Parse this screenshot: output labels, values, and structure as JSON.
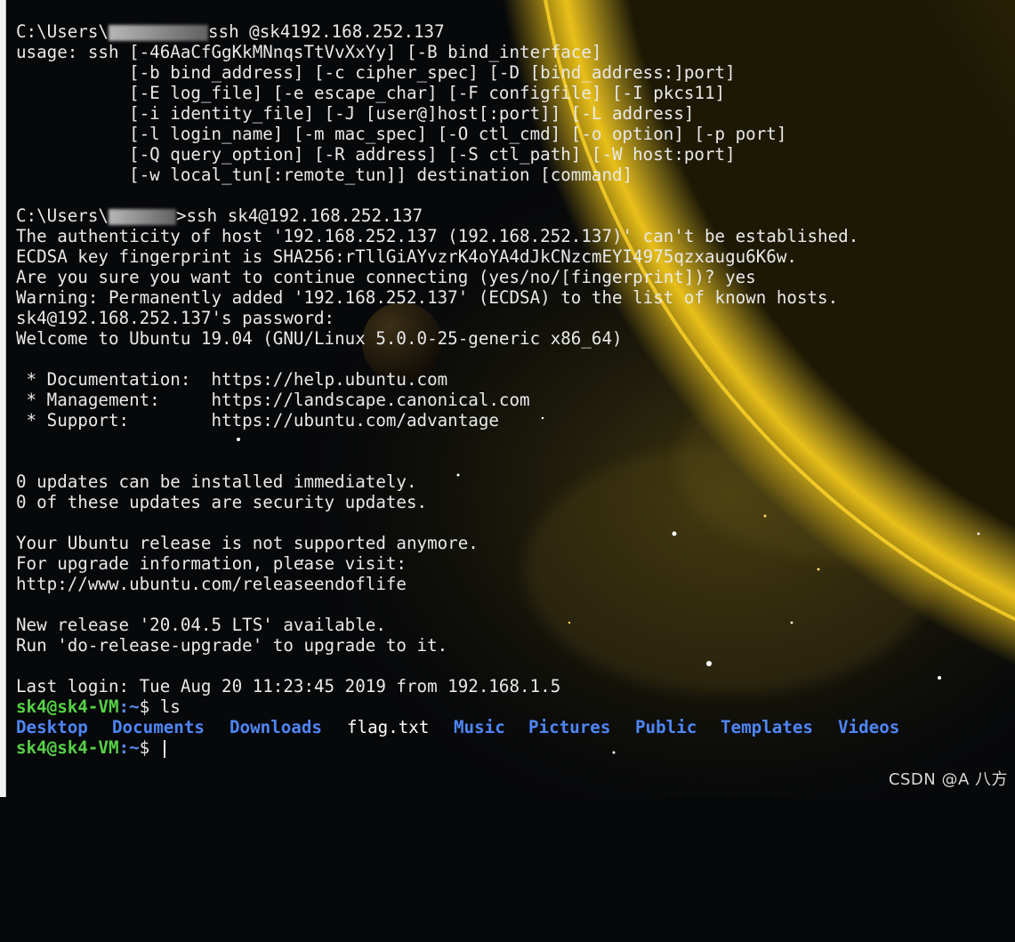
{
  "colors": {
    "background": "#07080a",
    "text": "#e9e9e9",
    "prompt_user": "#56d246",
    "prompt_path": "#5b8cf0",
    "directory": "#4f86f7",
    "planet_glow": "#f5c51a"
  },
  "terminal": {
    "line1": {
      "prefix": "C:\\Users\\",
      "suffix": "ssh @sk4192.168.252.137"
    },
    "usage": [
      "usage: ssh [-46AaCfGgKkMNnqsTtVvXxYy] [-B bind_interface]",
      "           [-b bind_address] [-c cipher_spec] [-D [bind_address:]port]",
      "           [-E log_file] [-e escape_char] [-F configfile] [-I pkcs11]",
      "           [-i identity_file] [-J [user@]host[:port]] [-L address]",
      "           [-l login_name] [-m mac_spec] [-O ctl_cmd] [-o option] [-p port]",
      "           [-Q query_option] [-R address] [-S ctl_path] [-W host:port]",
      "           [-w local_tun[:remote_tun]] destination [command]"
    ],
    "line2": {
      "prefix": "C:\\Users\\",
      "suffix": ">ssh sk4@192.168.252.137"
    },
    "session": [
      "The authenticity of host '192.168.252.137 (192.168.252.137)' can't be established.",
      "ECDSA key fingerprint is SHA256:rTllGiAYvzrK4oYA4dJkCNzcmEYI4975qzxaugu6K6w.",
      "Are you sure you want to continue connecting (yes/no/[fingerprint])? yes",
      "Warning: Permanently added '192.168.252.137' (ECDSA) to the list of known hosts.",
      "sk4@192.168.252.137's password:",
      "Welcome to Ubuntu 19.04 (GNU/Linux 5.0.0-25-generic x86_64)"
    ],
    "docs": [
      " * Documentation:  https://help.ubuntu.com",
      " * Management:     https://landscape.canonical.com",
      " * Support:        https://ubuntu.com/advantage"
    ],
    "updates": [
      "0 updates can be installed immediately.",
      "0 of these updates are security updates."
    ],
    "release": [
      "Your Ubuntu release is not supported anymore.",
      "For upgrade information, please visit:",
      "http://www.ubuntu.com/releaseendoflife"
    ],
    "upgrade": [
      "New release '20.04.5 LTS' available.",
      "Run 'do-release-upgrade' to upgrade to it."
    ],
    "last_login": "Last login: Tue Aug 20 11:23:45 2019 from 192.168.1.5",
    "prompt": {
      "user": "sk4@sk4-VM",
      "path": ":~",
      "symbol": "$ "
    },
    "command": "ls",
    "ls_output": [
      {
        "name": "Desktop",
        "type": "dir"
      },
      {
        "name": "Documents",
        "type": "dir"
      },
      {
        "name": "Downloads",
        "type": "dir"
      },
      {
        "name": "flag.txt",
        "type": "file"
      },
      {
        "name": "Music",
        "type": "dir"
      },
      {
        "name": "Pictures",
        "type": "dir"
      },
      {
        "name": "Public",
        "type": "dir"
      },
      {
        "name": "Templates",
        "type": "dir"
      },
      {
        "name": "Videos",
        "type": "dir"
      }
    ]
  },
  "watermark": "CSDN @A  八方"
}
